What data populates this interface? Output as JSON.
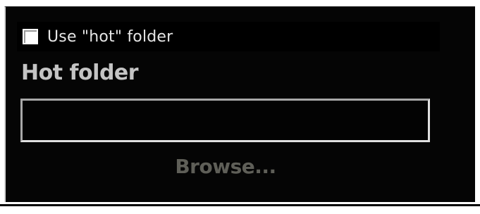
{
  "hot_folder_settings": {
    "use_hot_folder_label": "Use \"hot\" folder",
    "use_hot_folder_checked": false,
    "section_title": "Hot folder",
    "folder_path_value": "",
    "browse_label": "Browse...",
    "browse_enabled": false
  }
}
